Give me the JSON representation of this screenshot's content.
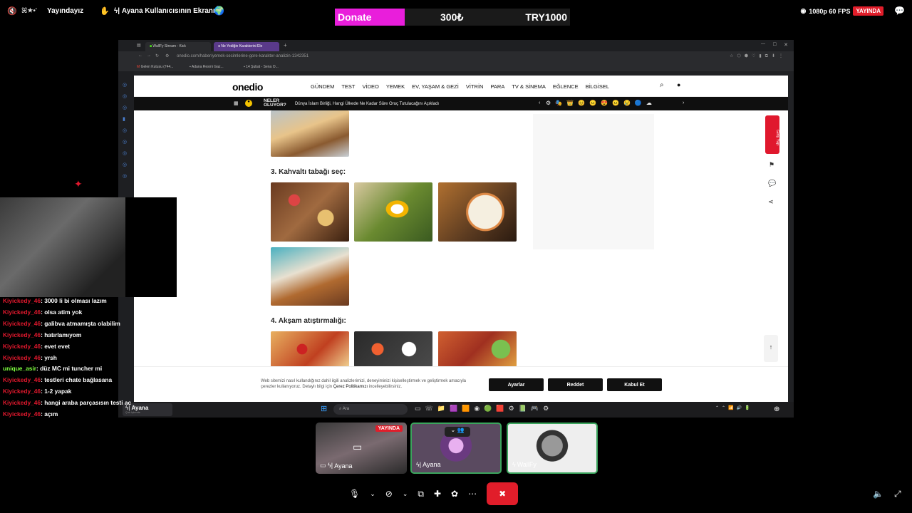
{
  "stream": {
    "status": "Yayındayız",
    "screen_title": "Ayana Kullanıcısının Ekranı",
    "donate_label": "Donate",
    "donate_amount": "300₺",
    "donate_goal": "TRY1000",
    "quality": "1080p 60 FPS",
    "live_badge": "YAYINDA"
  },
  "browser": {
    "tabs": [
      {
        "label": "WallFy Stream - Kick"
      },
      {
        "label": "Ne Yediğin Karakterini Ele"
      }
    ],
    "url": "onedio.com/haber/yemek-secimlerine-gore-karakter-analizin-1342351",
    "bookmarks": [
      "Gelen Kutusu (744...",
      "Adana Resmi Gaz...",
      "14 Şubat - Sena O..."
    ]
  },
  "page": {
    "logo": "onedio",
    "nav": [
      "GÜNDEM",
      "TEST",
      "VİDEO",
      "YEMEK",
      "EV, YAŞAM & GEZİ",
      "VİTRİN",
      "PARA",
      "TV & SİNEMA",
      "EĞLENCE",
      "BİLGİSEL"
    ],
    "ticker_label": "NELER OLUYOR?",
    "ticker_text": "Dünya İslam Birliği, Hangi Ülkede Ne Kadar Süre Oruç Tutulacağını Açıkladı",
    "q3": "3. Kahvaltı tabağı seç:",
    "q4": "4. Akşam atıştırmalığı:",
    "giris_yap": "Giriş Yap",
    "cookie_text1": "Web sitemizi nasıl kullandığınız dahil ilgili analizlerimizi, deneyiminizi kişiselleştirmek ve geliştirmek amacıyla",
    "cookie_text2": "çerezler kullanıyoruz. Detaylı bilgi için",
    "cookie_link": "Çerez Politikamızı",
    "cookie_text3": "incelleyebilirsiniz.",
    "btn_settings": "Ayarlar",
    "btn_reject": "Reddet",
    "btn_accept": "Kabul Et"
  },
  "taskbar": {
    "search": "Ara",
    "tile_user": "Ayana",
    "tile_sub": "Çok İşlemle"
  },
  "chat": [
    {
      "user": "Kiyickedy_46",
      "msg": ": 3000 li bi olması lazım"
    },
    {
      "user": "Kiyickedy_46",
      "msg": ": olsa atim yok"
    },
    {
      "user": "Kiyickedy_46",
      "msg": ": galibva atmamışta olabilim"
    },
    {
      "user": "Kiyickedy_46",
      "msg": ": hatırlamıyom"
    },
    {
      "user": "Kiyickedy_46",
      "msg": ": evet evet"
    },
    {
      "user": "Kiyickedy_46",
      "msg": ": yrsh"
    },
    {
      "user": "unique_asir",
      "msg": ": düz MC mi tuncher mi"
    },
    {
      "user": "Kiyickedy_46",
      "msg": ": testleri chate bağlasana"
    },
    {
      "user": "Kiyickedy_46",
      "msg": ": 1-2 yapak"
    },
    {
      "user": "Kiyickedy_46",
      "msg": ": hangi araba parçasısın testi ac"
    },
    {
      "user": "Kiyickedy_46",
      "msg": ": açım"
    }
  ],
  "call": {
    "tile1_name": "Ayana",
    "tile1_badge": "YAYINDA",
    "tile2_name": "Ayana",
    "tile3_name": "WallFy"
  },
  "colors": {
    "donate_pink": "#e91edb",
    "live_red": "#e11d2a",
    "chat_user": "#e0182d",
    "chat_user_alt": "#7fff3f",
    "end_call": "#e11d2a"
  }
}
